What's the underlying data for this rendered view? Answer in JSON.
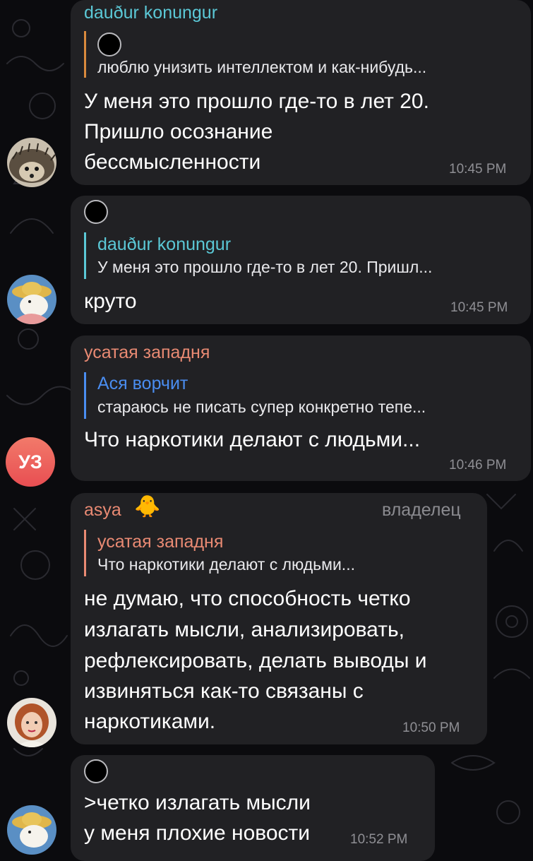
{
  "messages": [
    {
      "sender": "dauður konungur",
      "reply_text": "люблю унизить интеллектом и как-нибудь...",
      "lines": [
        "У меня это прошло где-то в лет 20.",
        "Пришло осознание",
        "бессмысленности"
      ],
      "time": "10:45 PM"
    },
    {
      "reply_sender": "dauður konungur",
      "reply_text": "У меня это прошло где-то в лет 20. Пришл...",
      "lines": [
        "круто"
      ],
      "time": "10:45 PM"
    },
    {
      "sender": "усатая западня",
      "reply_sender": "Ася ворчит",
      "reply_text": "стараюсь не писать супер конкретно тепе...",
      "lines": [
        "Что наркотики делают с людьми..."
      ],
      "time": "10:46 PM",
      "avatar_initials": "УЗ"
    },
    {
      "sender": "asya",
      "sender_emoji": "🐥",
      "role": "владелец",
      "reply_sender": "усатая западня",
      "reply_text": "Что наркотики делают с людьми...",
      "lines": [
        "не думаю, что способность четко",
        "излагать мысли, анализировать,",
        "рефлексировать, делать выводы и",
        "извиняться как-то связаны с",
        "наркотиками."
      ],
      "time": "10:50 PM"
    },
    {
      "lines": [
        ">четко излагать мысли",
        "у меня плохие новости"
      ],
      "time": "10:52 PM"
    }
  ],
  "colors": {
    "bubble": "#212124",
    "background": "#0b0b0e",
    "name_cyan": "#5bc8d6",
    "name_salmon": "#e98a73",
    "name_blue": "#4a8df0",
    "reply_orange": "#d98a3d",
    "avatar_uz": "#ee5a5a"
  },
  "icons": {
    "hedgehog": "hedgehog-avatar",
    "moomin": "moomin-avatar",
    "duck": "duck-emoji",
    "girl": "girl-avatar"
  }
}
